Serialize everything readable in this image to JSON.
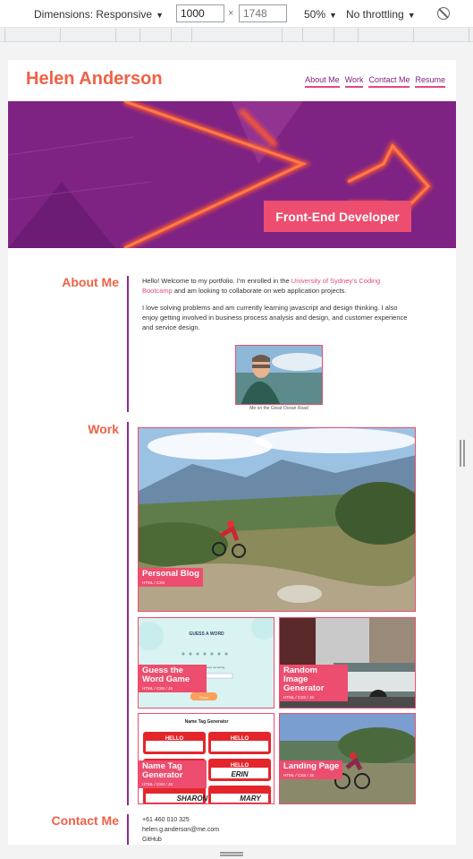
{
  "devtools": {
    "dimensions_label": "Dimensions: Responsive",
    "width_value": "1000",
    "times_sign": "×",
    "height_placeholder": "1748",
    "zoom_label": "50%",
    "throttling_label": "No throttling",
    "icons": [
      "caret-down-icon",
      "rotate-icon"
    ]
  },
  "site": {
    "title": "Helen Anderson",
    "nav": [
      "About Me",
      "Work",
      "Contact Me",
      "Resume"
    ],
    "hero_badge": "Front-End Developer"
  },
  "about": {
    "heading": "About Me",
    "p1_before": "Hello! Welcome to my portfolio. I'm enrolled in the ",
    "p1_link": "University of Sydney's Coding Bootcamp",
    "p1_after": " and am looking to collaborate on web application projects.",
    "p2": "I love solving problems and am currently learning javascript and design thinking. I also enjoy getting involved in business process analysis and design, and customer experience and service design.",
    "caption": "Me on the Great Ocean Road"
  },
  "work": {
    "heading": "Work",
    "projects": [
      {
        "title": "Personal Blog",
        "tags": "HTML / CSS"
      },
      {
        "title": "Guess the Word Game",
        "tags": "HTML / CSS / JS"
      },
      {
        "title": "Random Image Generator",
        "tags": "HTML / CSS / JS"
      },
      {
        "title": "Name Tag Generator",
        "tags": "HTML / CSS / JS"
      },
      {
        "title": "Landing Page",
        "tags": "HTML / CSS / JS"
      }
    ],
    "thumb_text": {
      "guess_title": "GUESS A WORD",
      "guess_hint": "You have 8 guesses remaining.",
      "guess_button": "Guess",
      "nametag_title": "Name Tag Generator",
      "nametag_hello": "HELLO",
      "nametag_names": [
        "ERIN",
        "SHARON",
        "MARY"
      ]
    }
  },
  "contact": {
    "heading": "Contact Me",
    "phone": "+61 460 010 325",
    "email": "helen.g.anderson@me.com",
    "github": "GitHub"
  },
  "colors": {
    "accent": "#f06146",
    "pink": "#ed4d6e",
    "purple": "#8e2a8f"
  }
}
